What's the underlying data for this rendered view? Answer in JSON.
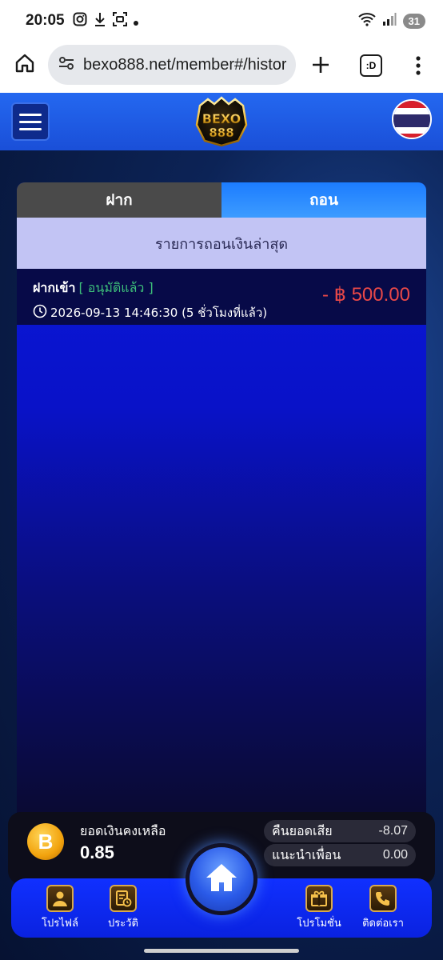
{
  "status_bar": {
    "time": "20:05",
    "battery": "31",
    "icons": [
      "instagram-icon",
      "download-icon",
      "screenshot-icon",
      "dot-icon",
      "wifi-icon",
      "signal-icon"
    ]
  },
  "browser": {
    "url": "bexo888.net/member#/histor",
    "tab_count_label": ":D",
    "icons": [
      "home-icon",
      "site-settings-icon",
      "new-tab-icon",
      "tabs-icon",
      "more-icon"
    ]
  },
  "header": {
    "logo_text": "BEXO 888",
    "flag": "thailand-flag"
  },
  "tabs": [
    {
      "label": "ฝาก",
      "active": false
    },
    {
      "label": "ถอน",
      "active": true
    }
  ],
  "subheader": "รายการถอนเงินล่าสุด",
  "transactions": [
    {
      "type": "ฝากเข้า",
      "status": "[ อนุมัติแล้ว ]",
      "time": "2026-09-13 14:46:30 (5 ชั่วโมงที่แล้ว)",
      "amount": "- ฿ 500.00"
    }
  ],
  "wallet": {
    "balance_label": "ยอดเงินคงเหลือ",
    "balance_value": "0.85",
    "coin_symbol": "B",
    "stats": [
      {
        "label": "คืนยอดเสีย",
        "value": "-8.07"
      },
      {
        "label": "แนะนำเพื่อน",
        "value": "0.00"
      }
    ]
  },
  "bottom_nav": {
    "items": [
      {
        "label": "โปรไฟล์",
        "icon": "profile-icon"
      },
      {
        "label": "ประวัติ",
        "icon": "history-icon"
      },
      {
        "label": "โปรโมชั่น",
        "icon": "promotion-icon"
      },
      {
        "label": "ติดต่อเรา",
        "icon": "contact-icon"
      }
    ],
    "home_icon": "home-icon"
  },
  "colors": {
    "header_blue": "#1a4fd8",
    "active_tab": "#3d9cff",
    "amount_red": "#e84848",
    "status_green": "#3dbf7a"
  }
}
